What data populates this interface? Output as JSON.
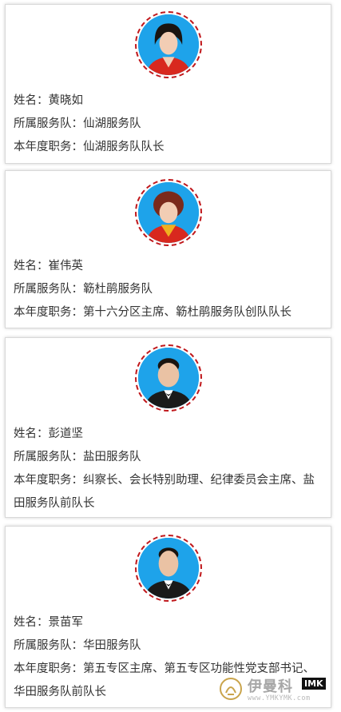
{
  "colors": {
    "accent_border": "#c0181c",
    "photo_background": "#1ea3ea",
    "text": "#333333"
  },
  "members": [
    {
      "name_line": "姓名：黄晓如",
      "team_line": "所属服务队：仙湖服务队",
      "role_line": "本年度职务：仙湖服务队队长",
      "photo_icon": "female-portrait-photo"
    },
    {
      "name_line": "姓名：崔伟英",
      "team_line": "所属服务队：簕杜鹃服务队",
      "role_line": "本年度职务：第十六分区主席、簕杜鹃服务队创队队长",
      "photo_icon": "female-portrait-photo"
    },
    {
      "name_line": "姓名：彭道坚",
      "team_line": "所属服务队：盐田服务队",
      "role_line": "本年度职务：纠察长、会长特别助理、纪律委员会主席、盐田服务队前队长",
      "photo_icon": "male-portrait-photo"
    },
    {
      "name_line": "姓名：景苗军",
      "team_line": "所属服务队：华田服务队",
      "role_line": "本年度职务：第五专区主席、第五专区功能性党支部书记、华田服务队前队长",
      "photo_icon": "male-portrait-photo"
    }
  ],
  "watermark": {
    "brand": "伊曼科",
    "tag": "IMK",
    "url": "www.YMKYMK.com",
    "logo_icon": "brand-logo-icon"
  }
}
